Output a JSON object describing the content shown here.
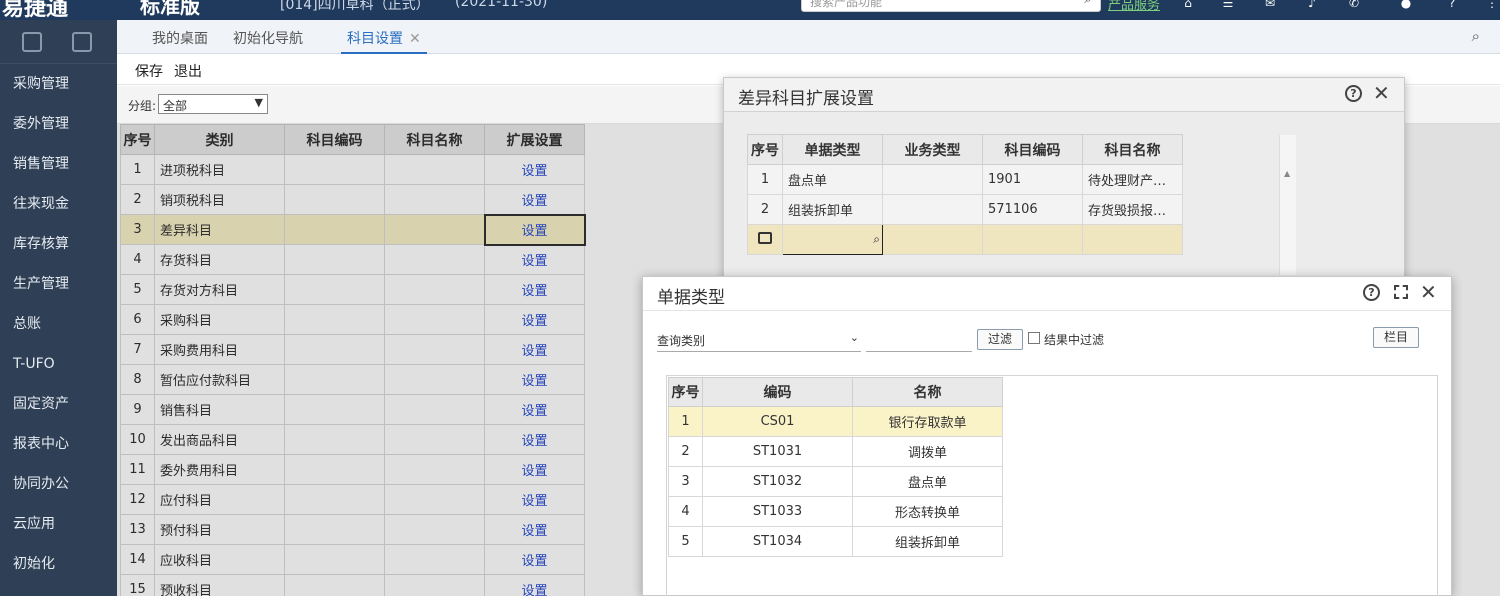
{
  "header": {
    "brand": "易捷通",
    "edition": "标准版",
    "account": "[014]四川草科（正式）",
    "period": "(2021-11-30)",
    "search_placeholder": "搜索产品功能",
    "link": "产品服务"
  },
  "sidebar": {
    "items": [
      "采购管理",
      "委外管理",
      "销售管理",
      "往来现金",
      "库存核算",
      "生产管理",
      "总账",
      "T-UFO",
      "固定资产",
      "报表中心",
      "协同办公",
      "云应用",
      "初始化"
    ]
  },
  "tabs": [
    {
      "label": "我的桌面"
    },
    {
      "label": "初始化导航"
    },
    {
      "label": "科目设置",
      "close": "✕"
    }
  ],
  "toolbar": {
    "save": "保存",
    "exit": "退出"
  },
  "filter": {
    "label": "分组:",
    "value": "全部"
  },
  "grid": {
    "headers": [
      "序号",
      "类别",
      "科目编码",
      "科目名称",
      "扩展设置"
    ],
    "set_label": "设置",
    "rows": [
      {
        "no": "1",
        "category": "进项税科目"
      },
      {
        "no": "2",
        "category": "销项税科目"
      },
      {
        "no": "3",
        "category": "差异科目"
      },
      {
        "no": "4",
        "category": "存货科目"
      },
      {
        "no": "5",
        "category": "存货对方科目"
      },
      {
        "no": "6",
        "category": "采购科目"
      },
      {
        "no": "7",
        "category": "采购费用科目"
      },
      {
        "no": "8",
        "category": "暂估应付款科目"
      },
      {
        "no": "9",
        "category": "销售科目"
      },
      {
        "no": "10",
        "category": "发出商品科目"
      },
      {
        "no": "11",
        "category": "委外费用科目"
      },
      {
        "no": "12",
        "category": "应付科目"
      },
      {
        "no": "13",
        "category": "预付科目"
      },
      {
        "no": "14",
        "category": "应收科目"
      },
      {
        "no": "15",
        "category": "预收科目"
      }
    ]
  },
  "dialog1": {
    "title": "差异科目扩展设置",
    "headers": [
      "序号",
      "单据类型",
      "业务类型",
      "科目编码",
      "科目名称"
    ],
    "rows": [
      {
        "no": "1",
        "doc_type": "盘点单",
        "biz_type": "",
        "code": "1901",
        "name": "待处理财产…"
      },
      {
        "no": "2",
        "doc_type": "组装拆卸单",
        "biz_type": "",
        "code": "571106",
        "name": "存货毁损报…"
      }
    ]
  },
  "dialog2": {
    "title": "单据类型",
    "query_select": "查询类别",
    "filter_button": "过滤",
    "checkbox_label": "结果中过滤",
    "columns_button": "栏目",
    "headers": [
      "序号",
      "编码",
      "名称"
    ],
    "rows": [
      {
        "no": "1",
        "code": "CS01",
        "name": "银行存取款单"
      },
      {
        "no": "2",
        "code": "ST1031",
        "name": "调拨单"
      },
      {
        "no": "3",
        "code": "ST1032",
        "name": "盘点单"
      },
      {
        "no": "4",
        "code": "ST1033",
        "name": "形态转换单"
      },
      {
        "no": "5",
        "code": "ST1034",
        "name": "组装拆卸单"
      }
    ]
  }
}
